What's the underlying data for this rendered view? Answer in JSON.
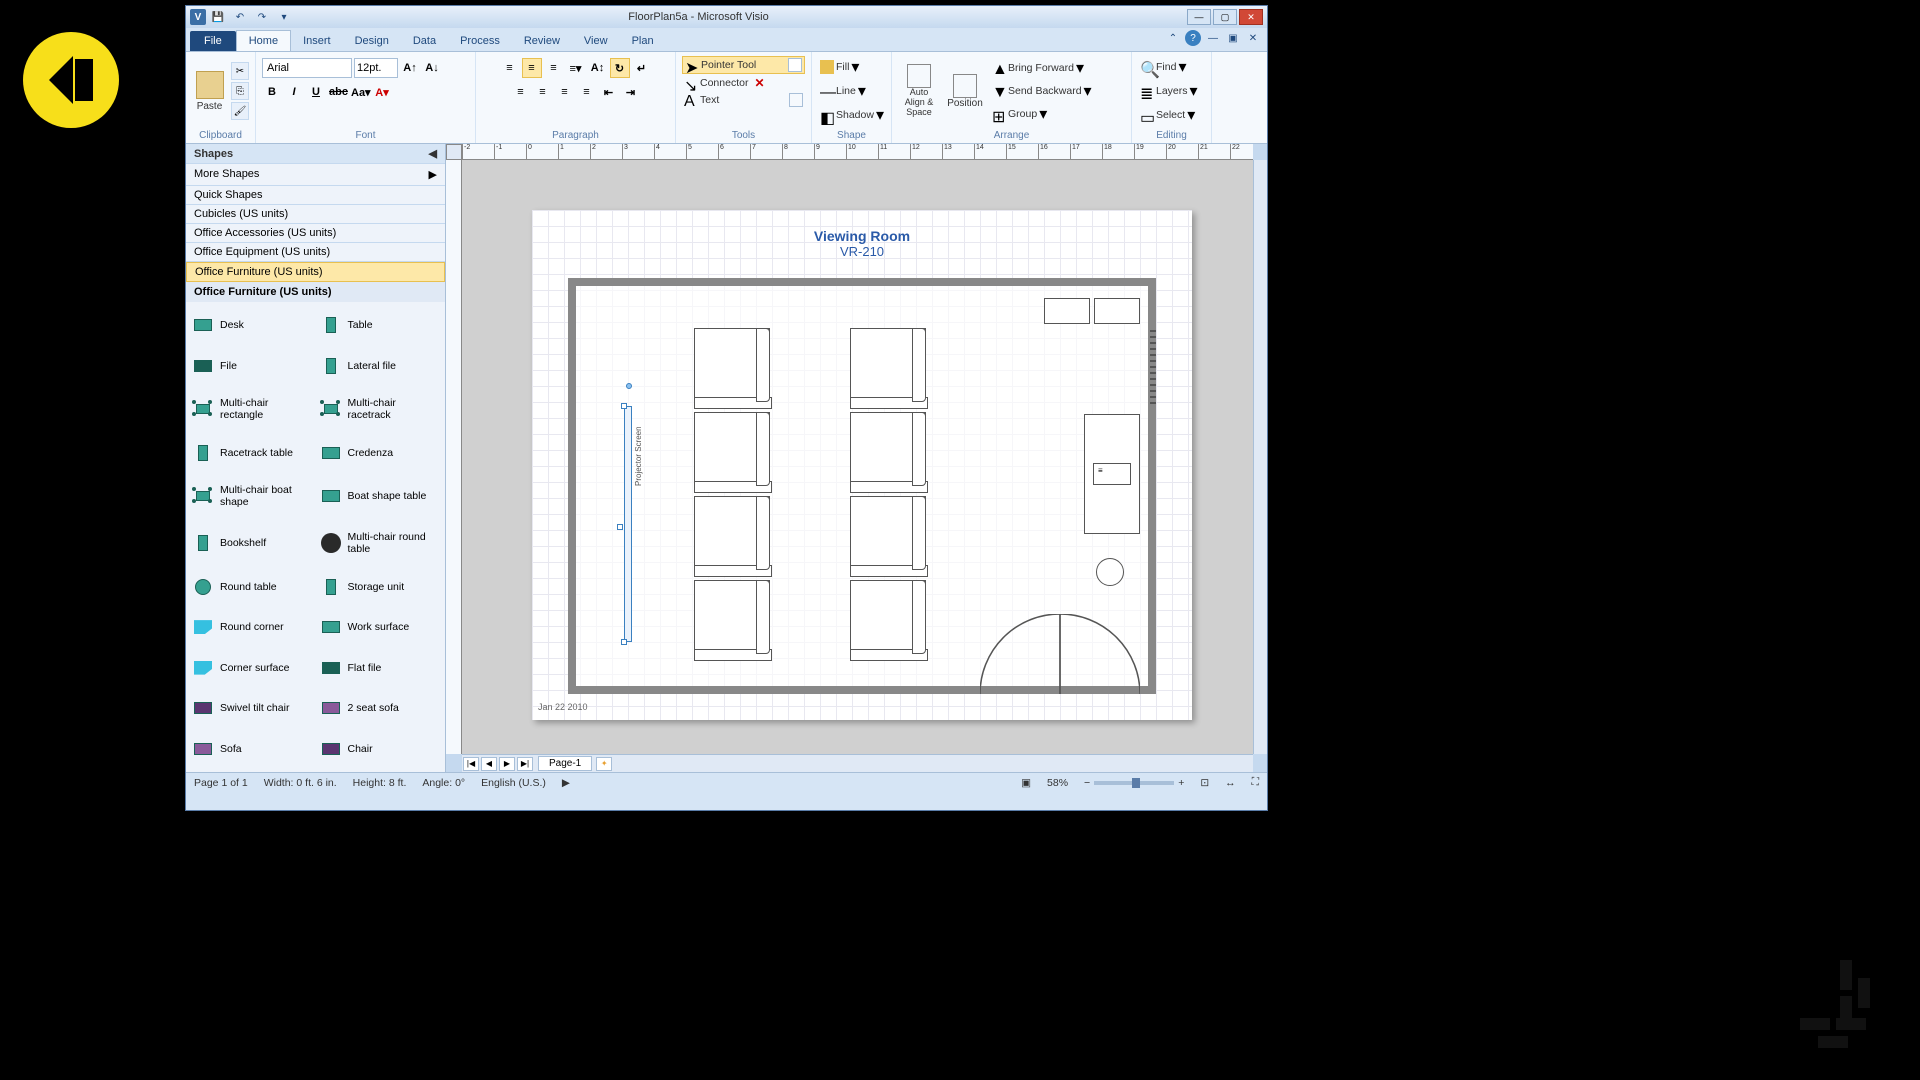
{
  "window": {
    "title": "FloorPlan5a - Microsoft Visio"
  },
  "tabs": [
    "File",
    "Home",
    "Insert",
    "Design",
    "Data",
    "Process",
    "Review",
    "View",
    "Plan"
  ],
  "active_tab": "Home",
  "ribbon": {
    "clipboard": {
      "paste": "Paste",
      "label": "Clipboard"
    },
    "font": {
      "name": "Arial",
      "size": "12pt.",
      "label": "Font"
    },
    "paragraph": {
      "label": "Paragraph"
    },
    "tools": {
      "pointer": "Pointer Tool",
      "connector": "Connector",
      "text": "Text",
      "label": "Tools"
    },
    "shape": {
      "fill": "Fill",
      "line": "Line",
      "shadow": "Shadow",
      "label": "Shape"
    },
    "arrange": {
      "autoalign": "Auto Align & Space",
      "position": "Position",
      "bringfwd": "Bring Forward",
      "sendback": "Send Backward",
      "group": "Group",
      "label": "Arrange"
    },
    "editing": {
      "find": "Find",
      "layers": "Layers",
      "select": "Select",
      "label": "Editing"
    }
  },
  "shapes_panel": {
    "header": "Shapes",
    "more": "More Shapes",
    "categories": [
      "Quick Shapes",
      "Cubicles (US units)",
      "Office Accessories (US units)",
      "Office Equipment (US units)",
      "Office Furniture (US units)"
    ],
    "selected_category": "Office Furniture (US units)",
    "stencil_title": "Office Furniture (US units)",
    "shapes": [
      {
        "name": "Desk",
        "icon": "rect"
      },
      {
        "name": "Table",
        "icon": "rect-tall"
      },
      {
        "name": "File",
        "icon": "rect-dark"
      },
      {
        "name": "Lateral file",
        "icon": "rect-tall"
      },
      {
        "name": "Multi-chair rectangle",
        "icon": "multi"
      },
      {
        "name": "Multi-chair racetrack",
        "icon": "multi"
      },
      {
        "name": "Racetrack table",
        "icon": "rect-tall"
      },
      {
        "name": "Credenza",
        "icon": "rect"
      },
      {
        "name": "Multi-chair boat shape",
        "icon": "multi"
      },
      {
        "name": "Boat shape table",
        "icon": "rect"
      },
      {
        "name": "Bookshelf",
        "icon": "rect-tall"
      },
      {
        "name": "Multi-chair round table",
        "icon": "gear"
      },
      {
        "name": "Round table",
        "icon": "circle"
      },
      {
        "name": "Storage unit",
        "icon": "rect-tall"
      },
      {
        "name": "Round corner",
        "icon": "cut"
      },
      {
        "name": "Work surface",
        "icon": "rect"
      },
      {
        "name": "Corner surface",
        "icon": "cut"
      },
      {
        "name": "Flat file",
        "icon": "rect-dark"
      },
      {
        "name": "Swivel tilt chair",
        "icon": "rect-purple"
      },
      {
        "name": "2 seat sofa",
        "icon": "rect-lpurple"
      },
      {
        "name": "Sofa",
        "icon": "rect-lpurple"
      },
      {
        "name": "Chair",
        "icon": "rect-purple"
      }
    ]
  },
  "drawing": {
    "title": "Viewing Room",
    "subtitle": "VR-210",
    "screen_label": "Projector Screen",
    "date": "Jan 22 2010",
    "page_tab": "Page-1"
  },
  "status": {
    "page": "Page 1 of 1",
    "width": "Width: 0 ft. 6 in.",
    "height": "Height: 8 ft.",
    "angle": "Angle: 0°",
    "lang": "English (U.S.)",
    "zoom": "58%"
  }
}
